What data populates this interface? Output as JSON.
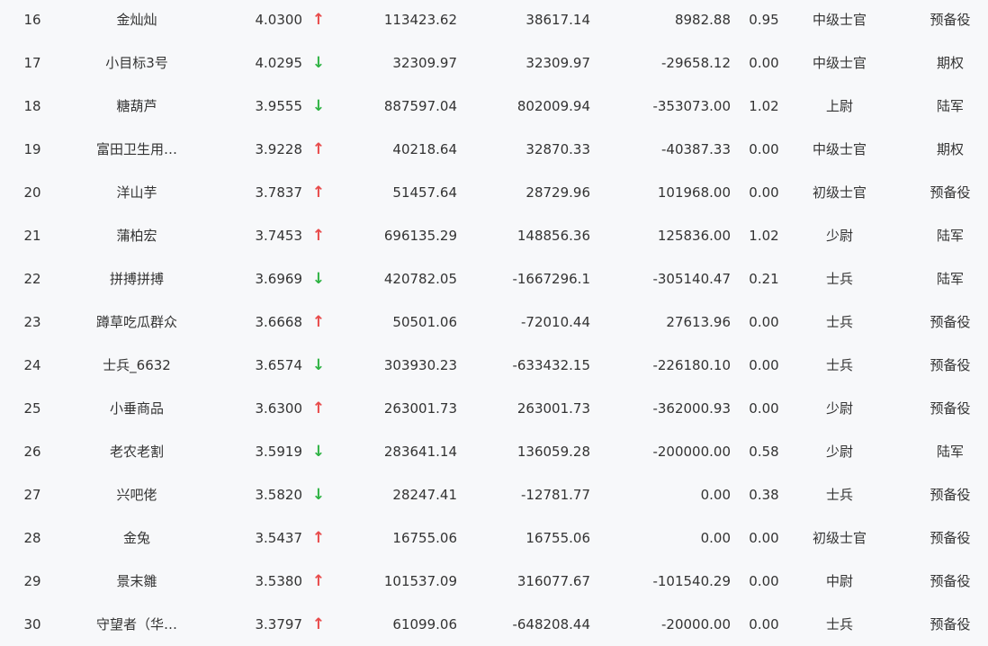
{
  "colors": {
    "background": "#f7f8fa",
    "text": "#333333",
    "up_arrow": "#e84a4a",
    "down_arrow": "#2fb344"
  },
  "arrow_icons": {
    "up": "↑",
    "down": "↓"
  },
  "rows": [
    {
      "rank": "16",
      "name": "金灿灿",
      "value": "4.0300",
      "trend": "up",
      "amount1": "113423.62",
      "amount2": "38617.14",
      "amount3": "8982.88",
      "ratio": "0.95",
      "level": "中级士官",
      "type": "预备役"
    },
    {
      "rank": "17",
      "name": "小目标3号",
      "value": "4.0295",
      "trend": "down",
      "amount1": "32309.97",
      "amount2": "32309.97",
      "amount3": "-29658.12",
      "ratio": "0.00",
      "level": "中级士官",
      "type": "期权"
    },
    {
      "rank": "18",
      "name": "糖葫芦",
      "value": "3.9555",
      "trend": "down",
      "amount1": "887597.04",
      "amount2": "802009.94",
      "amount3": "-353073.00",
      "ratio": "1.02",
      "level": "上尉",
      "type": "陆军"
    },
    {
      "rank": "19",
      "name": "富田卫生用…",
      "value": "3.9228",
      "trend": "up",
      "amount1": "40218.64",
      "amount2": "32870.33",
      "amount3": "-40387.33",
      "ratio": "0.00",
      "level": "中级士官",
      "type": "期权"
    },
    {
      "rank": "20",
      "name": "洋山芋",
      "value": "3.7837",
      "trend": "up",
      "amount1": "51457.64",
      "amount2": "28729.96",
      "amount3": "101968.00",
      "ratio": "0.00",
      "level": "初级士官",
      "type": "预备役"
    },
    {
      "rank": "21",
      "name": "蒲柏宏",
      "value": "3.7453",
      "trend": "up",
      "amount1": "696135.29",
      "amount2": "148856.36",
      "amount3": "125836.00",
      "ratio": "1.02",
      "level": "少尉",
      "type": "陆军"
    },
    {
      "rank": "22",
      "name": "拼搏拼搏",
      "value": "3.6969",
      "trend": "down",
      "amount1": "420782.05",
      "amount2": "-1667296.1",
      "amount3": "-305140.47",
      "ratio": "0.21",
      "level": "士兵",
      "type": "陆军"
    },
    {
      "rank": "23",
      "name": "蹲草吃瓜群众",
      "value": "3.6668",
      "trend": "up",
      "amount1": "50501.06",
      "amount2": "-72010.44",
      "amount3": "27613.96",
      "ratio": "0.00",
      "level": "士兵",
      "type": "预备役"
    },
    {
      "rank": "24",
      "name": "士兵_6632",
      "value": "3.6574",
      "trend": "down",
      "amount1": "303930.23",
      "amount2": "-633432.15",
      "amount3": "-226180.10",
      "ratio": "0.00",
      "level": "士兵",
      "type": "预备役"
    },
    {
      "rank": "25",
      "name": "小垂商品",
      "value": "3.6300",
      "trend": "up",
      "amount1": "263001.73",
      "amount2": "263001.73",
      "amount3": "-362000.93",
      "ratio": "0.00",
      "level": "少尉",
      "type": "预备役"
    },
    {
      "rank": "26",
      "name": "老农老割",
      "value": "3.5919",
      "trend": "down",
      "amount1": "283641.14",
      "amount2": "136059.28",
      "amount3": "-200000.00",
      "ratio": "0.58",
      "level": "少尉",
      "type": "陆军"
    },
    {
      "rank": "27",
      "name": "兴吧佬",
      "value": "3.5820",
      "trend": "down",
      "amount1": "28247.41",
      "amount2": "-12781.77",
      "amount3": "0.00",
      "ratio": "0.38",
      "level": "士兵",
      "type": "预备役"
    },
    {
      "rank": "28",
      "name": "金兔",
      "value": "3.5437",
      "trend": "up",
      "amount1": "16755.06",
      "amount2": "16755.06",
      "amount3": "0.00",
      "ratio": "0.00",
      "level": "初级士官",
      "type": "预备役"
    },
    {
      "rank": "29",
      "name": "景末雛",
      "value": "3.5380",
      "trend": "up",
      "amount1": "101537.09",
      "amount2": "316077.67",
      "amount3": "-101540.29",
      "ratio": "0.00",
      "level": "中尉",
      "type": "预备役"
    },
    {
      "rank": "30",
      "name": "守望者（华…",
      "value": "3.3797",
      "trend": "up",
      "amount1": "61099.06",
      "amount2": "-648208.44",
      "amount3": "-20000.00",
      "ratio": "0.00",
      "level": "士兵",
      "type": "预备役"
    }
  ]
}
